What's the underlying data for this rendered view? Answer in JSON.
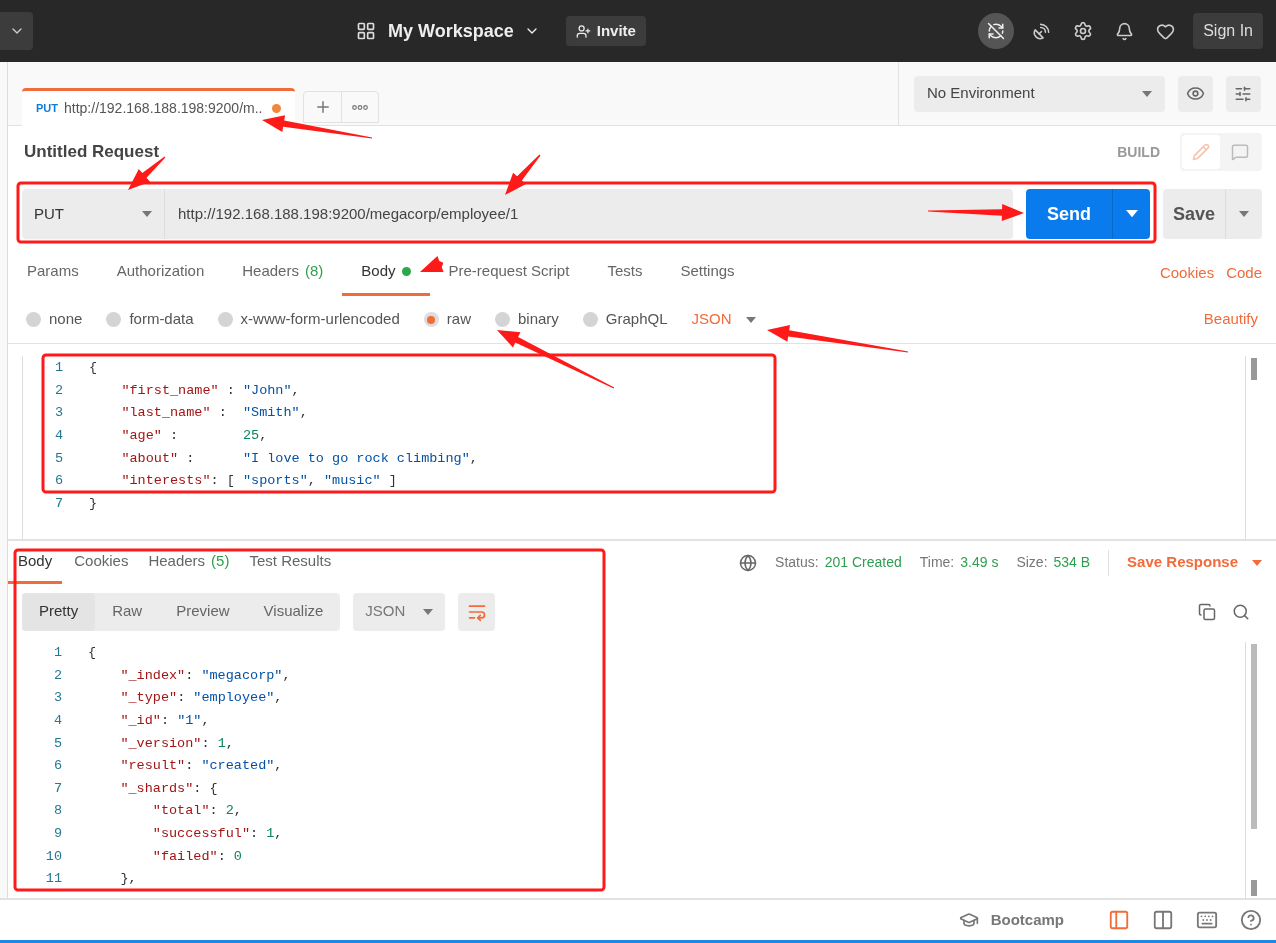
{
  "topbar": {
    "workspace": "My Workspace",
    "invite": "Invite",
    "sign_in": "Sign In"
  },
  "open_tabs": [
    {
      "method": "PUT",
      "title": "http://192.168.188.198:9200/m..",
      "unsaved": true,
      "selected": true
    }
  ],
  "environment": {
    "value": "No Environment"
  },
  "request": {
    "title": "Untitled Request",
    "mode": "BUILD",
    "method": "PUT",
    "url": "http://192.168.188.198:9200/megacorp/employee/1",
    "send": "Send",
    "save": "Save"
  },
  "request_nav": [
    {
      "label": "Params",
      "selected": false,
      "modified": false
    },
    {
      "label": "Authorization",
      "selected": false,
      "modified": false
    },
    {
      "label": "Headers",
      "count": "(8)",
      "selected": false,
      "modified": false
    },
    {
      "label": "Body",
      "selected": true,
      "modified": true
    },
    {
      "label": "Pre-request Script",
      "selected": false,
      "modified": false
    },
    {
      "label": "Tests",
      "selected": false,
      "modified": false
    },
    {
      "label": "Settings",
      "selected": false,
      "modified": false
    }
  ],
  "request_links": [
    "Cookies",
    "Code"
  ],
  "body_types": [
    {
      "label": "none",
      "selected": false
    },
    {
      "label": "form-data",
      "selected": false
    },
    {
      "label": "x-www-form-urlencoded",
      "selected": false
    },
    {
      "label": "raw",
      "selected": true
    },
    {
      "label": "binary",
      "selected": false
    },
    {
      "label": "GraphQL",
      "selected": false
    }
  ],
  "body_format": "JSON",
  "beautify": "Beautify",
  "request_body": [
    {
      "number": "1",
      "tokens": [
        {
          "kind": "punct",
          "text": "{"
        }
      ]
    },
    {
      "number": "2",
      "tokens": [
        {
          "kind": "key",
          "text": "    \"first_name\""
        },
        {
          "kind": "punct",
          "text": " : "
        },
        {
          "kind": "str",
          "text": "\"John\""
        },
        {
          "kind": "punct",
          "text": ","
        }
      ]
    },
    {
      "number": "3",
      "tokens": [
        {
          "kind": "key",
          "text": "    \"last_name\""
        },
        {
          "kind": "punct",
          "text": " :  "
        },
        {
          "kind": "str",
          "text": "\"Smith\""
        },
        {
          "kind": "punct",
          "text": ","
        }
      ]
    },
    {
      "number": "4",
      "tokens": [
        {
          "kind": "key",
          "text": "    \"age\""
        },
        {
          "kind": "punct",
          "text": " :        "
        },
        {
          "kind": "num",
          "text": "25"
        },
        {
          "kind": "punct",
          "text": ","
        }
      ]
    },
    {
      "number": "5",
      "tokens": [
        {
          "kind": "key",
          "text": "    \"about\""
        },
        {
          "kind": "punct",
          "text": " :      "
        },
        {
          "kind": "str",
          "text": "\"I love to go rock climbing\""
        },
        {
          "kind": "punct",
          "text": ","
        }
      ]
    },
    {
      "number": "6",
      "tokens": [
        {
          "kind": "key",
          "text": "    \"interests\""
        },
        {
          "kind": "punct",
          "text": ": [ "
        },
        {
          "kind": "str",
          "text": "\"sports\""
        },
        {
          "kind": "punct",
          "text": ", "
        },
        {
          "kind": "str",
          "text": "\"music\""
        },
        {
          "kind": "punct",
          "text": " ]"
        }
      ]
    },
    {
      "number": "7",
      "tokens": [
        {
          "kind": "punct",
          "text": "}"
        }
      ]
    }
  ],
  "response": {
    "tabs": [
      {
        "label": "Body",
        "selected": true
      },
      {
        "label": "Cookies",
        "selected": false
      },
      {
        "label": "Headers",
        "count": "(5)",
        "selected": false
      },
      {
        "label": "Test Results",
        "selected": false
      }
    ],
    "status_label": "Status:",
    "status": "201 Created",
    "time_label": "Time:",
    "time": "3.49 s",
    "size_label": "Size:",
    "size": "534 B",
    "save": "Save Response",
    "views": [
      {
        "label": "Pretty",
        "selected": true
      },
      {
        "label": "Raw",
        "selected": false
      },
      {
        "label": "Preview",
        "selected": false
      },
      {
        "label": "Visualize",
        "selected": false
      }
    ],
    "format": "JSON",
    "lines": [
      {
        "number": "1",
        "tokens": [
          {
            "kind": "punct",
            "text": "{"
          }
        ]
      },
      {
        "number": "2",
        "tokens": [
          {
            "kind": "key",
            "text": "    \"_index\""
          },
          {
            "kind": "punct",
            "text": ": "
          },
          {
            "kind": "str",
            "text": "\"megacorp\""
          },
          {
            "kind": "punct",
            "text": ","
          }
        ]
      },
      {
        "number": "3",
        "tokens": [
          {
            "kind": "key",
            "text": "    \"_type\""
          },
          {
            "kind": "punct",
            "text": ": "
          },
          {
            "kind": "str",
            "text": "\"employee\""
          },
          {
            "kind": "punct",
            "text": ","
          }
        ]
      },
      {
        "number": "4",
        "tokens": [
          {
            "kind": "key",
            "text": "    \"_id\""
          },
          {
            "kind": "punct",
            "text": ": "
          },
          {
            "kind": "str",
            "text": "\"1\""
          },
          {
            "kind": "punct",
            "text": ","
          }
        ]
      },
      {
        "number": "5",
        "tokens": [
          {
            "kind": "key",
            "text": "    \"_version\""
          },
          {
            "kind": "punct",
            "text": ": "
          },
          {
            "kind": "num",
            "text": "1"
          },
          {
            "kind": "punct",
            "text": ","
          }
        ]
      },
      {
        "number": "6",
        "tokens": [
          {
            "kind": "key",
            "text": "    \"result\""
          },
          {
            "kind": "punct",
            "text": ": "
          },
          {
            "kind": "str",
            "text": "\"created\""
          },
          {
            "kind": "punct",
            "text": ","
          }
        ]
      },
      {
        "number": "7",
        "tokens": [
          {
            "kind": "key",
            "text": "    \"_shards\""
          },
          {
            "kind": "punct",
            "text": ": {"
          }
        ]
      },
      {
        "number": "8",
        "tokens": [
          {
            "kind": "key",
            "text": "        \"total\""
          },
          {
            "kind": "punct",
            "text": ": "
          },
          {
            "kind": "num",
            "text": "2"
          },
          {
            "kind": "punct",
            "text": ","
          }
        ]
      },
      {
        "number": "9",
        "tokens": [
          {
            "kind": "key",
            "text": "        \"successful\""
          },
          {
            "kind": "punct",
            "text": ": "
          },
          {
            "kind": "num",
            "text": "1"
          },
          {
            "kind": "punct",
            "text": ","
          }
        ]
      },
      {
        "number": "10",
        "tokens": [
          {
            "kind": "key",
            "text": "        \"failed\""
          },
          {
            "kind": "punct",
            "text": ": "
          },
          {
            "kind": "num",
            "text": "0"
          }
        ]
      },
      {
        "number": "11",
        "tokens": [
          {
            "kind": "punct",
            "text": "    },"
          }
        ]
      }
    ]
  },
  "footer": {
    "bootcamp": "Bootcamp",
    "layouts": [
      {
        "kind": "single",
        "selected": true
      },
      {
        "kind": "split",
        "selected": false
      }
    ]
  }
}
